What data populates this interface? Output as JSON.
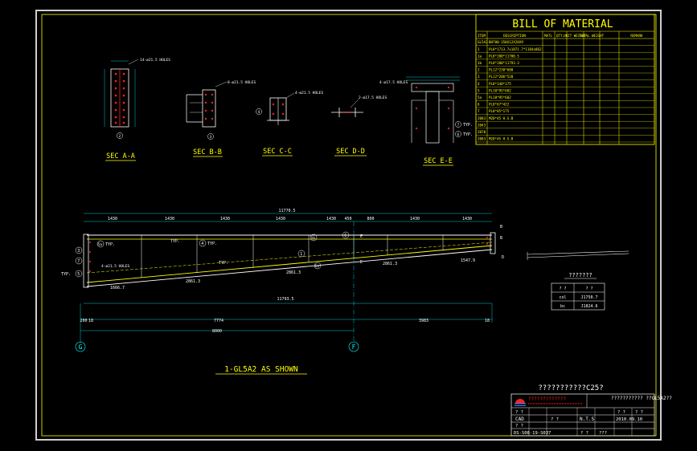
{
  "colors": {
    "background": "#000000",
    "frame": "#d8d8d8",
    "yellow": "#ffff00",
    "white": "#ffffff",
    "cyan": "#00ffff",
    "red": "#ff2020",
    "green": "#33ff33"
  },
  "bom": {
    "title": "BILL  OF  MATERIAL",
    "headers": [
      "ITEM",
      "DESCRIPTION",
      "MATL",
      "QTY.",
      "UNIT WEIGHT",
      "TOTAL WEIGHT",
      "REMARK"
    ],
    "rows": [
      [
        "GL5A2",
        "BH700-350X12X20X9"
      ],
      [
        "1",
        "PL8*1713.7x1871.7*1184x862"
      ],
      [
        "1a",
        "PL8*200*11780.5"
      ],
      [
        "1b",
        "PL8*200*11793.3"
      ],
      [
        "2",
        "PL12*230*600"
      ],
      [
        "3",
        "PL12*206*520"
      ],
      [
        "4",
        "PL8*140*175"
      ],
      [
        "5",
        "PL10*95*602"
      ],
      [
        "5a",
        "PL10*95*602"
      ],
      [
        "6",
        "PL8*67*422"
      ],
      [
        "7",
        "PL8*85*175"
      ],
      [
        "2083",
        "M20*45 H.S.B"
      ],
      [
        "2043",
        ""
      ],
      [
        "2070",
        ""
      ],
      [
        "2083",
        "M20*45 H.S.B"
      ]
    ]
  },
  "sections": {
    "a": "SEC  A-A",
    "b": "SEC  B-B",
    "c": "SEC  C-C",
    "d": "SEC  D-D",
    "e": "SEC  E-E"
  },
  "beam": {
    "overall": "11770.5",
    "segments": [
      "1430",
      "1430",
      "1430",
      "1430",
      "1430",
      "450",
      "800",
      "1430",
      "1430"
    ],
    "lengths": [
      "1666.7",
      "2861.3",
      "2861.3",
      "2861.3",
      "1547.9",
      "11793.5"
    ],
    "bottom_dims": [
      "200",
      "18",
      "7774",
      "3983",
      "18"
    ],
    "total": "8000",
    "grids": [
      "G",
      "F"
    ],
    "caption": "1-GL5A2  AS  SHOWN",
    "typ": "TYP."
  },
  "side_table": {
    "title": "???????",
    "headers": [
      "? ?",
      "? ?"
    ],
    "rows": [
      [
        "col",
        "J1750.7"
      ],
      [
        "bc",
        "J1824.6"
      ]
    ]
  },
  "title_block": {
    "project": "???????????C25?",
    "company": "?????????????",
    "drawing_name": "??????????? ??GL5A2??",
    "scale": "N.T.S",
    "date": "2010.09.10",
    "drawing_no": "DS-S08-19-S037",
    "cad": "CAD",
    "q1": "? ?",
    "q2": "? ?",
    "q3": "???"
  }
}
